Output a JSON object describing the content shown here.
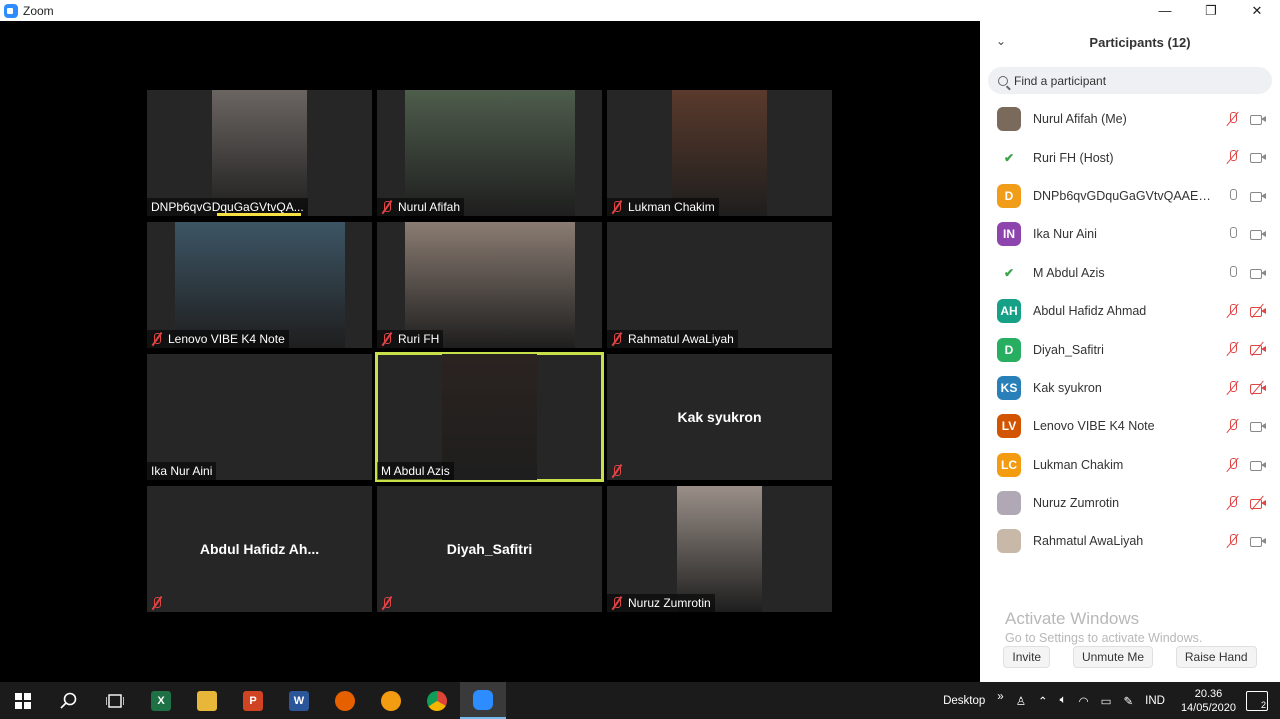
{
  "window": {
    "title": "Zoom",
    "minimize": "—",
    "maximize": "❐",
    "close": "✕"
  },
  "tiles": [
    {
      "name": "DNPb6qvGDquGaGVtvQA...",
      "muted": false,
      "video": true,
      "videoColor": "#6b6562",
      "videoLeft": 65,
      "videoWidth": 95,
      "speaking": true
    },
    {
      "name": "Nurul Afifah",
      "muted": true,
      "video": true,
      "videoColor": "#4e5d4c",
      "videoLeft": 28,
      "videoWidth": 170
    },
    {
      "name": "Lukman Chakim",
      "muted": true,
      "video": true,
      "videoColor": "#5a3a2c",
      "videoLeft": 65,
      "videoWidth": 95
    },
    {
      "name": "Lenovo VIBE K4 Note",
      "muted": true,
      "video": true,
      "videoColor": "#3d5565",
      "videoLeft": 28,
      "videoWidth": 170
    },
    {
      "name": "Ruri FH",
      "muted": true,
      "video": true,
      "videoColor": "#8a7c72",
      "videoLeft": 28,
      "videoWidth": 170
    },
    {
      "name": "Rahmatul AwaLiyah",
      "muted": true,
      "video": false
    },
    {
      "name": "Ika Nur Aini",
      "muted": false,
      "video": false
    },
    {
      "name": "M Abdul Azis",
      "muted": false,
      "video": true,
      "videoColor": "#2b2320",
      "videoLeft": 65,
      "videoWidth": 95,
      "active": true
    },
    {
      "name": "",
      "centerName": "Kak syukron",
      "muted": true,
      "video": false
    },
    {
      "name": "",
      "centerName": "Abdul  Hafidz  Ah...",
      "muted": true,
      "video": false
    },
    {
      "name": "",
      "centerName": "Diyah_Safitri",
      "muted": true,
      "video": false
    },
    {
      "name": "Nuruz Zumrotin",
      "muted": true,
      "video": true,
      "videoColor": "#9a8f88",
      "videoLeft": 70,
      "videoWidth": 85
    }
  ],
  "panel": {
    "title": "Participants (12)",
    "search_placeholder": "Find a participant",
    "participants": [
      {
        "name": "Nurul Afifah (Me)",
        "initials": "",
        "avatarColor": "#7a6a5c",
        "micMuted": true,
        "camOff": false
      },
      {
        "name": "Ruri FH (Host)",
        "initials": "",
        "avatarColor": "#ffffff",
        "logo": true,
        "micMuted": true,
        "camOff": false
      },
      {
        "name": "DNPb6qvGDquGaGVtvQAAEAAA...",
        "initials": "D",
        "avatarColor": "#f29d1a",
        "micMuted": false,
        "camOff": false
      },
      {
        "name": "Ika Nur Aini",
        "initials": "IN",
        "avatarColor": "#8e44ad",
        "micMuted": false,
        "camOff": false
      },
      {
        "name": "M Abdul Azis",
        "initials": "",
        "avatarColor": "#ffffff",
        "logo": true,
        "micMuted": false,
        "camOff": false
      },
      {
        "name": "Abdul Hafidz Ahmad",
        "initials": "AH",
        "avatarColor": "#16a085",
        "micMuted": true,
        "camOff": true
      },
      {
        "name": "Diyah_Safitri",
        "initials": "D",
        "avatarColor": "#27ae60",
        "micMuted": true,
        "camOff": true
      },
      {
        "name": "Kak syukron",
        "initials": "KS",
        "avatarColor": "#2980b9",
        "micMuted": true,
        "camOff": true
      },
      {
        "name": "Lenovo VIBE K4 Note",
        "initials": "LV",
        "avatarColor": "#d35400",
        "micMuted": true,
        "camOff": false
      },
      {
        "name": "Lukman Chakim",
        "initials": "LC",
        "avatarColor": "#f39c12",
        "micMuted": true,
        "camOff": false
      },
      {
        "name": "Nuruz Zumrotin",
        "initials": "",
        "avatarColor": "#b0a8b5",
        "micMuted": true,
        "camOff": true
      },
      {
        "name": "Rahmatul AwaLiyah",
        "initials": "",
        "avatarColor": "#c7b8a8",
        "micMuted": true,
        "camOff": false
      }
    ],
    "activate_line1": "Activate Windows",
    "activate_line2": "Go to Settings to activate Windows.",
    "invite": "Invite",
    "unmute": "Unmute Me",
    "raise_hand": "Raise Hand"
  },
  "taskbar": {
    "desktop": "Desktop",
    "chevron": "»",
    "language": "IND",
    "time": "20.36",
    "date": "14/05/2020",
    "notifications": "2"
  }
}
